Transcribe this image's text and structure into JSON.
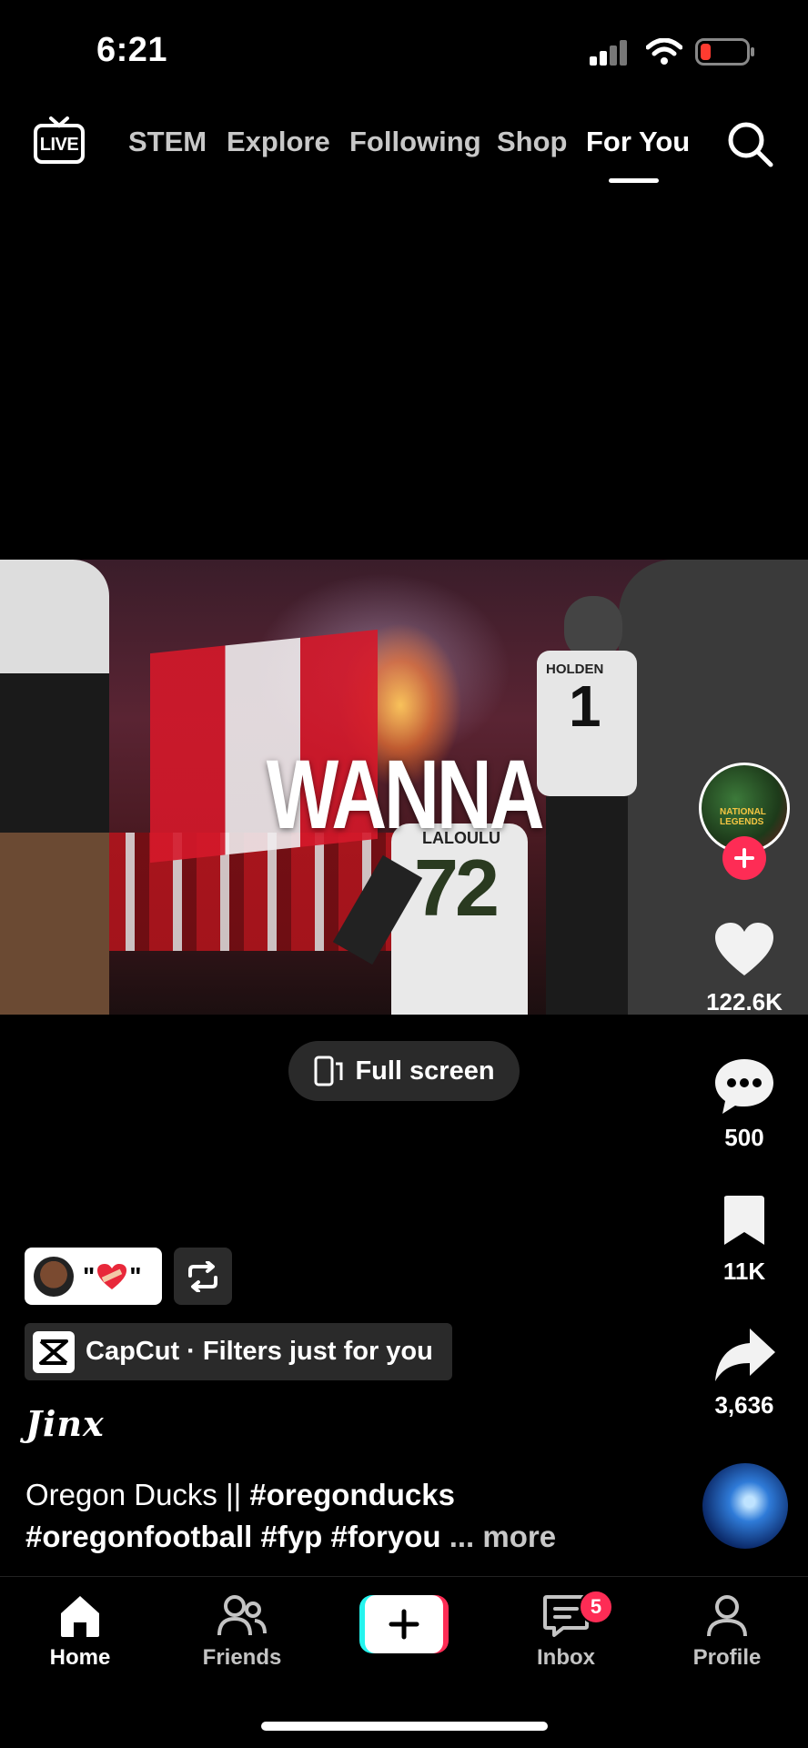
{
  "status_bar": {
    "time": "6:21"
  },
  "top_nav": {
    "live_label": "LIVE",
    "tabs": [
      {
        "label": "STEM",
        "active": false
      },
      {
        "label": "Explore",
        "active": false
      },
      {
        "label": "Following",
        "active": false
      },
      {
        "label": "Shop",
        "active": false
      },
      {
        "label": "For You",
        "active": true
      }
    ]
  },
  "video": {
    "overlay_text": "WANNA",
    "player_names": [
      "HOLDEN",
      "LALOULU"
    ],
    "jersey_numbers": [
      "1",
      "72"
    ],
    "avatar_text": "NATIONAL LEGENDS"
  },
  "fullscreen_button": {
    "label": "Full screen"
  },
  "right_rail": {
    "likes": "122.6K",
    "comments": "500",
    "saves": "11K",
    "shares": "3,636"
  },
  "post": {
    "sticker_text": "\"",
    "sticker_text_end": "\"",
    "capcut_label": "CapCut · Filters just for you",
    "username": "Jinx",
    "caption_plain": "Oregon Ducks || ",
    "caption_tags_line1": "#oregonducks",
    "caption_tags_line2": "#oregonfootball #fyp #foryou",
    "caption_more": "... more"
  },
  "bottom_nav": {
    "items": [
      {
        "label": "Home",
        "active": true
      },
      {
        "label": "Friends",
        "active": false
      },
      {
        "label": "",
        "active": false
      },
      {
        "label": "Inbox",
        "active": false
      },
      {
        "label": "Profile",
        "active": false
      }
    ],
    "inbox_badge": "5"
  },
  "colors": {
    "accent_pink": "#fe2c55",
    "accent_cyan": "#25f4ee",
    "battery_low": "#ff3b30",
    "background": "#000000"
  }
}
